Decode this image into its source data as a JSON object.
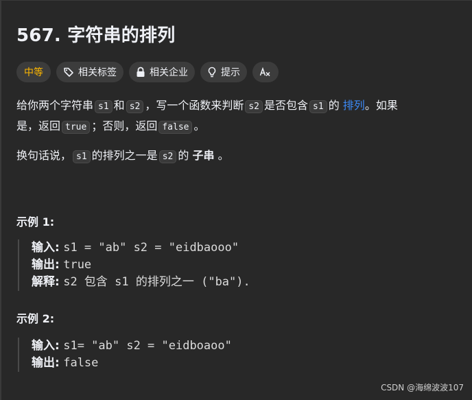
{
  "problem": {
    "title": "567. 字符串的排列"
  },
  "tags": {
    "difficulty": "中等",
    "related_tags": "相关标签",
    "related_companies": "相关企业",
    "hint": "提示"
  },
  "description": {
    "p1": {
      "t1": "给你两个字符串",
      "c1": "s1",
      "t2": "和",
      "c2": "s2",
      "t3": "，写一个函数来判断",
      "c3": "s2",
      "t4": "是否包含",
      "c4": "s1",
      "t5": "的",
      "link": "排列",
      "t6": "。如果",
      "t7": "是，返回",
      "c5": "true",
      "t8": "；否则，返回",
      "c6": "false",
      "t9": "。"
    },
    "p2": {
      "t1": "换句话说，",
      "c1": "s1",
      "t2": "的排列之一是",
      "c2": "s2",
      "t3": "的",
      "strong": "子串",
      "t4": "。"
    }
  },
  "examples": [
    {
      "title": "示例 1:",
      "input_label": "输入:",
      "input_value": "s1 = \"ab\" s2 = \"eidbaooo\"",
      "output_label": "输出:",
      "output_value": "true",
      "explain_label": "解释:",
      "explain_value": "s2 包含 s1 的排列之一 (\"ba\")."
    },
    {
      "title": "示例 2:",
      "input_label": "输入:",
      "input_value": "s1= \"ab\" s2 = \"eidboaoo\"",
      "output_label": "输出:",
      "output_value": "false"
    }
  ],
  "watermark": "CSDN @海绵波波107",
  "colors": {
    "background": "#282828",
    "difficulty": "#ffb800",
    "link": "#3c89f5",
    "text": "#eff1f6"
  },
  "icons": {
    "related_tags": "tag-icon",
    "related_companies": "lock-icon",
    "hint": "lightbulb-icon",
    "translate": "translate-icon"
  }
}
